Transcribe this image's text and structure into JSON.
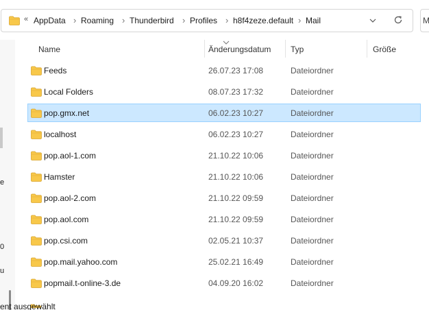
{
  "address": {
    "overflow_label": "«",
    "breadcrumbs": [
      "AppData",
      "Roaming",
      "Thunderbird",
      "Profiles",
      "h8f4zeze.default",
      "Mail"
    ],
    "separator": "›"
  },
  "search": {
    "label": "M"
  },
  "nav_fragments": [
    "e",
    "0",
    "u"
  ],
  "columns": {
    "name": "Name",
    "date": "Änderungsdatum",
    "type": "Typ",
    "size": "Größe"
  },
  "rows": [
    {
      "name": "Feeds",
      "date": "26.07.23 17:08",
      "type": "Dateiordner",
      "size": ""
    },
    {
      "name": "Local Folders",
      "date": "08.07.23 17:32",
      "type": "Dateiordner",
      "size": ""
    },
    {
      "name": "pop.gmx.net",
      "date": "06.02.23 10:27",
      "type": "Dateiordner",
      "size": ""
    },
    {
      "name": "localhost",
      "date": "06.02.23 10:27",
      "type": "Dateiordner",
      "size": ""
    },
    {
      "name": "pop.aol-1.com",
      "date": "21.10.22 10:06",
      "type": "Dateiordner",
      "size": ""
    },
    {
      "name": "Hamster",
      "date": "21.10.22 10:06",
      "type": "Dateiordner",
      "size": ""
    },
    {
      "name": "pop.aol-2.com",
      "date": "21.10.22 09:59",
      "type": "Dateiordner",
      "size": ""
    },
    {
      "name": "pop.aol.com",
      "date": "21.10.22 09:59",
      "type": "Dateiordner",
      "size": ""
    },
    {
      "name": "pop.csi.com",
      "date": "02.05.21 10:37",
      "type": "Dateiordner",
      "size": ""
    },
    {
      "name": "pop.mail.yahoo.com",
      "date": "25.02.21 16:49",
      "type": "Dateiordner",
      "size": ""
    },
    {
      "name": "popmail.t-online-3.de",
      "date": "04.09.20 16:02",
      "type": "Dateiordner",
      "size": ""
    }
  ],
  "selected_row": "pop.gmx.net",
  "status": {
    "text": "ent ausgewählt"
  },
  "colors": {
    "selection_bg": "#cce8ff",
    "selection_border": "#99d1ff",
    "folder_yellow": "#f8c84a"
  }
}
